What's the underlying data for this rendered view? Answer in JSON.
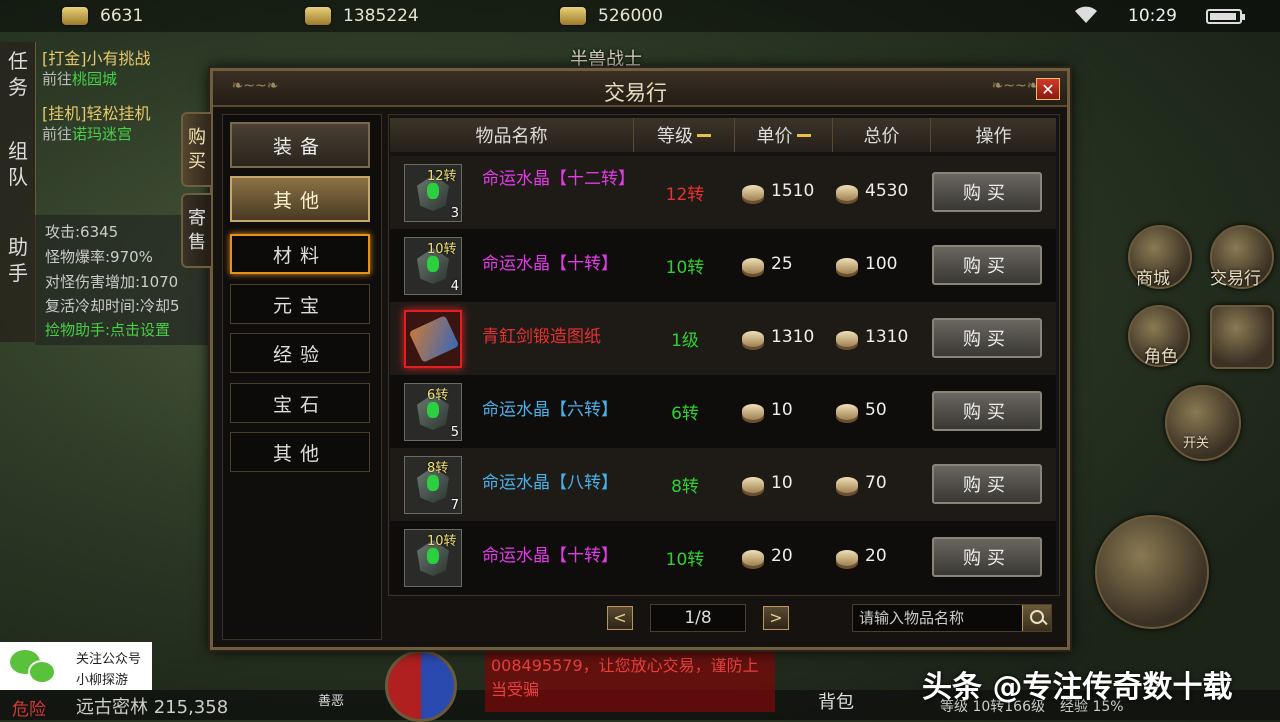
{
  "status": {
    "currencies": [
      {
        "icon": "gold-coin-icon",
        "value": "6631"
      },
      {
        "icon": "gold-ingot-icon",
        "value": "1385224"
      },
      {
        "icon": "treasure-icon",
        "value": "526000"
      }
    ],
    "time": "10:29"
  },
  "zone_name": "半兽战士",
  "quests": {
    "tab1": "任务",
    "tab2": "组队",
    "tab3": "助手",
    "items": [
      {
        "title": "[打金]小有挑战",
        "prefix": "前往",
        "dest": "桃园城"
      },
      {
        "title": "[挂机]轻松挂机",
        "prefix": "前往",
        "dest": "诺玛迷宫"
      }
    ]
  },
  "stats": [
    "攻击:6345",
    "怪物爆率:970%",
    "对怪伤害增加:1070",
    "复活冷却时间:冷却5",
    "捡物助手:点击设置"
  ],
  "right_menu": {
    "shop": "商城",
    "trade": "交易行",
    "role": "角色",
    "toggle": "开关"
  },
  "bottom": {
    "danger": "危险",
    "location": "远古密林 215,358",
    "chat": "008495579，让您放心交易，谨防上当受骗",
    "level": "等级  10转166级",
    "exp": "经验 15%",
    "watermark": "头条 @专注传奇数十载",
    "wechat_line1": "关注公众号",
    "wechat_line2": "小柳探游",
    "bag": "背包",
    "good_evil": "善恶"
  },
  "dialog": {
    "title": "交易行",
    "side_tabs": [
      "购买",
      "寄售"
    ],
    "categories": [
      {
        "label": "装备",
        "style": "big"
      },
      {
        "label": "其他",
        "style": "big sel"
      },
      {
        "label": "材料",
        "style": "hl"
      },
      {
        "label": "元宝",
        "style": ""
      },
      {
        "label": "经验",
        "style": ""
      },
      {
        "label": "宝石",
        "style": ""
      },
      {
        "label": "其他",
        "style": ""
      }
    ],
    "headers": {
      "name": "物品名称",
      "level": "等级",
      "unit": "单价",
      "total": "总价",
      "action": "操作"
    },
    "rows": [
      {
        "zhuan": "12转",
        "count": "3",
        "name": "命运水晶【十二转】",
        "name_color": "#e23ae8",
        "level": "12转",
        "level_color": "#e83030",
        "unit": "1510",
        "total": "4530",
        "buy": "购买",
        "icon": "crystal"
      },
      {
        "zhuan": "10转",
        "count": "4",
        "name": "命运水晶【十转】",
        "name_color": "#e23ae8",
        "level": "10转",
        "level_color": "#30d030",
        "unit": "25",
        "total": "100",
        "buy": "购买",
        "icon": "crystal"
      },
      {
        "zhuan": "",
        "count": "",
        "name": "青釭剑锻造图纸",
        "name_color": "#e83030",
        "level": "1级",
        "level_color": "#30d030",
        "unit": "1310",
        "total": "1310",
        "buy": "购买",
        "icon": "scroll"
      },
      {
        "zhuan": "6转",
        "count": "5",
        "name": "命运水晶【六转】",
        "name_color": "#4ab0e8",
        "level": "6转",
        "level_color": "#30d030",
        "unit": "10",
        "total": "50",
        "buy": "购买",
        "icon": "crystal"
      },
      {
        "zhuan": "8转",
        "count": "7",
        "name": "命运水晶【八转】",
        "name_color": "#4ab0e8",
        "level": "8转",
        "level_color": "#30d030",
        "unit": "10",
        "total": "70",
        "buy": "购买",
        "icon": "crystal"
      },
      {
        "zhuan": "10转",
        "count": "",
        "name": "命运水晶【十转】",
        "name_color": "#e23ae8",
        "level": "10转",
        "level_color": "#30d030",
        "unit": "20",
        "total": "20",
        "buy": "购买",
        "icon": "crystal"
      }
    ],
    "pagination": {
      "prev": "<",
      "page": "1/8",
      "next": ">"
    },
    "search_placeholder": "请输入物品名称"
  }
}
